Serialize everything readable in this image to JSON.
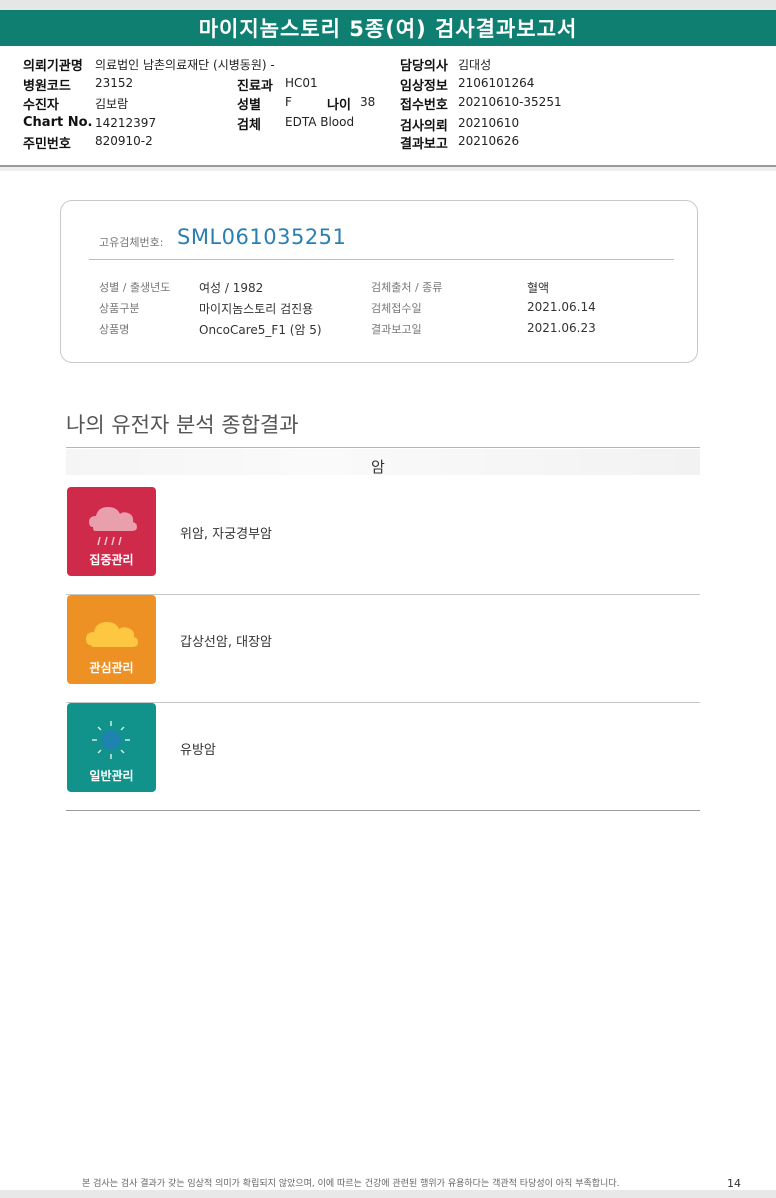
{
  "title": "마이지놈스토리 5종(여) 검사결과보고서",
  "header": {
    "institution_label": "의뢰기관명",
    "institution_value": "의료법인 남촌의료재단 (시병동원) -",
    "hospital_code_label": "병원코드",
    "hospital_code_value": "23152",
    "dept_label": "진료과",
    "dept_value": "HC01",
    "recipient_label": "수진자",
    "recipient_value": "김보람",
    "sex_label": "성별",
    "sex_value": "F",
    "age_label": "나이",
    "age_value": "38",
    "chart_label": "Chart No.",
    "chart_value": "14212397",
    "specimen_label": "검체",
    "specimen_value": "EDTA Blood",
    "rrn_label": "주민번호",
    "rrn_value": "820910-2",
    "doctor_label": "담당의사",
    "doctor_value": "김대성",
    "clinical_label": "임상정보",
    "clinical_value": "2106101264",
    "receipt_no_label": "접수번호",
    "receipt_no_value": "20210610-35251",
    "request_label": "검사의뢰",
    "request_value": "20210610",
    "report_label": "결과보고",
    "report_value": "20210626"
  },
  "card": {
    "sample_id_label": "고유검체번호:",
    "sample_id_value": "SML061035251",
    "fields_left": [
      {
        "label": "성별 / 출생년도",
        "value": "여성 / 1982"
      },
      {
        "label": "상품구분",
        "value": "마이지놈스토리 검진용"
      },
      {
        "label": "상품명",
        "value": "OncoCare5_F1 (암 5)"
      }
    ],
    "fields_right": [
      {
        "label": "검체출처 / 종류",
        "value": "혈액"
      },
      {
        "label": "검체접수일",
        "value": "2021.06.14"
      },
      {
        "label": "결과보고일",
        "value": "2021.06.23"
      }
    ]
  },
  "section_title": "나의 유전자 분석 종합결과",
  "category_label": "암",
  "rows": [
    {
      "badge": "집중관리",
      "icon": "rain-cloud-icon",
      "color": "#d02a4b",
      "description": "위암, 자궁경부암"
    },
    {
      "badge": "관심관리",
      "icon": "cloud-icon",
      "color": "#ee9124",
      "description": "갑상선암, 대장암"
    },
    {
      "badge": "일반관리",
      "icon": "sun-icon",
      "color": "#11938b",
      "description": "유방암"
    }
  ],
  "footer_note": "본 검사는 검사 결과가 갖는 임상적 의미가 확립되지 않았으며, 이에 따르는 건강에 관련된 행위가 유용하다는 객관적 타당성이 아직 부족합니다.",
  "page_number": "14"
}
